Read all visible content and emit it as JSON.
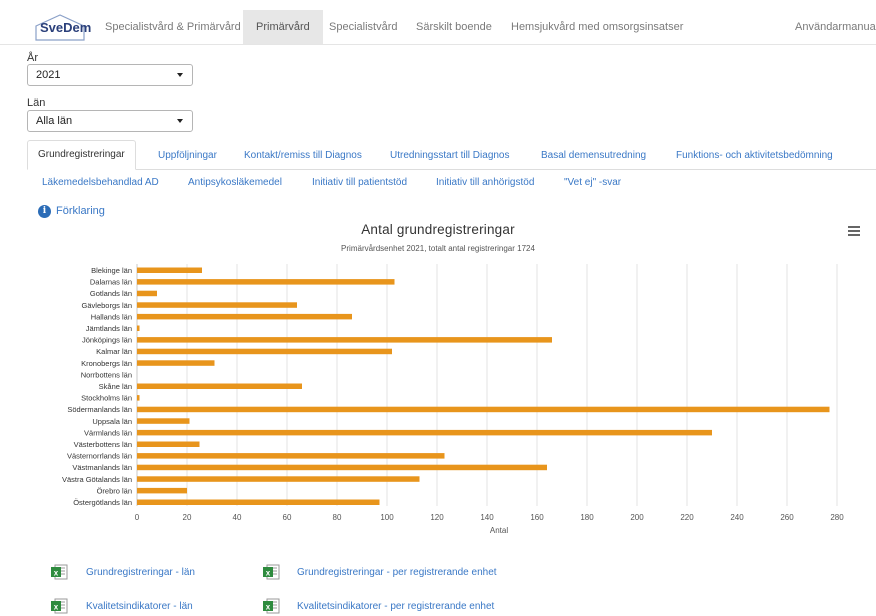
{
  "nav": {
    "logo": "SveDem",
    "items": [
      {
        "label": "Specialistvård & Primärvård",
        "active": false
      },
      {
        "label": "Primärvård",
        "active": true
      },
      {
        "label": "Specialistvård",
        "active": false
      },
      {
        "label": "Särskilt boende",
        "active": false
      },
      {
        "label": "Hemsjukvård med omsorgsinsatser",
        "active": false
      },
      {
        "label": "Användarmanual",
        "active": false
      }
    ]
  },
  "filters": {
    "year_label": "År",
    "year_value": "2021",
    "county_label": "Län",
    "county_value": "Alla län"
  },
  "tabs_row1": [
    {
      "label": "Grundregistreringar",
      "active": true
    },
    {
      "label": "Uppföljningar",
      "active": false
    },
    {
      "label": "Kontakt/remiss till Diagnos",
      "active": false
    },
    {
      "label": "Utredningsstart till Diagnos",
      "active": false
    },
    {
      "label": "Basal demensutredning",
      "active": false
    },
    {
      "label": "Funktions- och aktivitetsbedömning",
      "active": false
    }
  ],
  "tabs_row2": [
    {
      "label": "Läkemedelsbehandlad AD"
    },
    {
      "label": "Antipsykosläkemedel"
    },
    {
      "label": "Initiativ till patientstöd"
    },
    {
      "label": "Initiativ till anhörigstöd"
    },
    {
      "label": "\"Vet ej\" -svar"
    }
  ],
  "info": {
    "label": "Förklaring",
    "icon": "info-icon"
  },
  "chart_data": {
    "type": "bar",
    "orientation": "horizontal",
    "title": "Antal grundregistreringar",
    "subtitle": "Primärvårdsenhet 2021, totalt antal registreringar 1724",
    "xlabel": "Antal",
    "ylabel": "",
    "xlim": [
      0,
      290
    ],
    "xticks": [
      "0",
      "20",
      "40",
      "60",
      "80",
      "100",
      "120",
      "140",
      "160",
      "180",
      "200",
      "220",
      "240",
      "260",
      "280"
    ],
    "grid": true,
    "bar_color": "#e8951c",
    "categories": [
      "Blekinge län",
      "Dalarnas län",
      "Gotlands län",
      "Gävleborgs län",
      "Hallands län",
      "Jämtlands län",
      "Jönköpings län",
      "Kalmar län",
      "Kronobergs län",
      "Norrbottens län",
      "Skåne län",
      "Stockholms län",
      "Södermanlands län",
      "Uppsala län",
      "Värmlands län",
      "Västerbottens län",
      "Västernorrlands län",
      "Västmanlands län",
      "Västra Götalands län",
      "Örebro län",
      "Östergötlands län"
    ],
    "values": [
      26,
      103,
      8,
      64,
      86,
      1,
      166,
      102,
      31,
      0,
      66,
      1,
      277,
      21,
      230,
      25,
      123,
      164,
      113,
      20,
      97
    ]
  },
  "downloads": [
    {
      "label": "Grundregistreringar - län",
      "icon": "excel-icon"
    },
    {
      "label": "Grundregistreringar - per registrerande enhet",
      "icon": "excel-icon"
    },
    {
      "label": "Kvalitetsindikatorer - län",
      "icon": "excel-icon"
    },
    {
      "label": "Kvalitetsindikatorer - per registrerande enhet",
      "icon": "excel-icon"
    }
  ]
}
